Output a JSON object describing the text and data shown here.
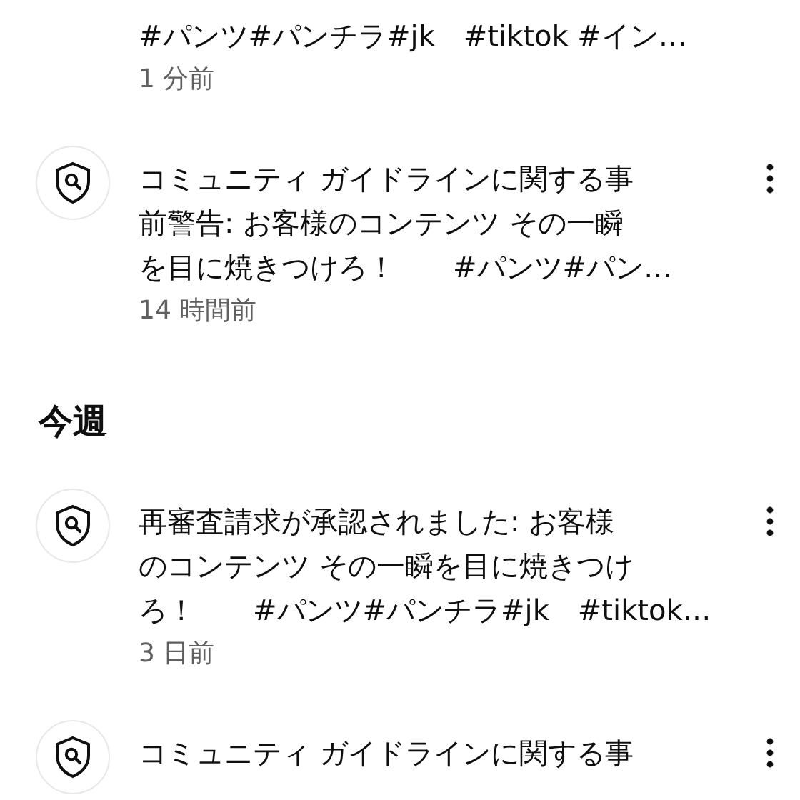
{
  "notifications": [
    {
      "kind": "continued",
      "title_lines": [
        "#パンツ#パンチラ#jk　#tiktok #イン…"
      ],
      "time": "1 分前"
    },
    {
      "kind": "full",
      "title_lines": [
        "コミュニティ ガイドラインに関する事",
        "前警告: お客様のコンテンツ その一瞬",
        "を目に焼きつけろ！　　#パンツ#パン…"
      ],
      "time": "14 時間前"
    }
  ],
  "sections": [
    {
      "heading": "今週",
      "notifications": [
        {
          "kind": "full",
          "title_lines": [
            "再審査請求が承認されました: お客様",
            "のコンテンツ その一瞬を目に焼きつけ",
            "ろ！　　#パンツ#パンチラ#jk　#tiktok…"
          ],
          "time": "3 日前"
        },
        {
          "kind": "full",
          "title_lines": [
            "コミュニティ ガイドラインに関する事"
          ]
        }
      ]
    }
  ]
}
